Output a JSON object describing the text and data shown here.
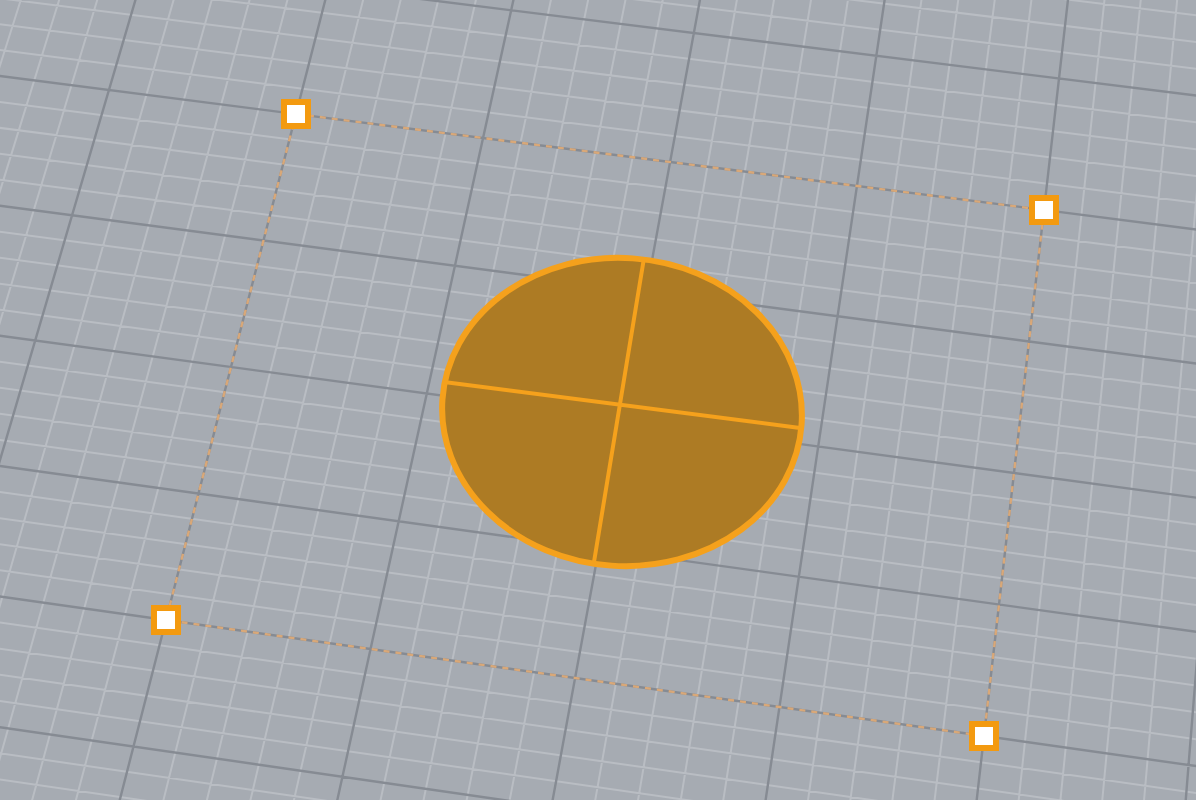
{
  "viewport": {
    "objects": [
      {
        "kind": "disc",
        "selected": true
      }
    ],
    "handles": [
      {
        "kind": "corner"
      },
      {
        "kind": "corner"
      },
      {
        "kind": "corner"
      },
      {
        "kind": "corner"
      }
    ]
  }
}
